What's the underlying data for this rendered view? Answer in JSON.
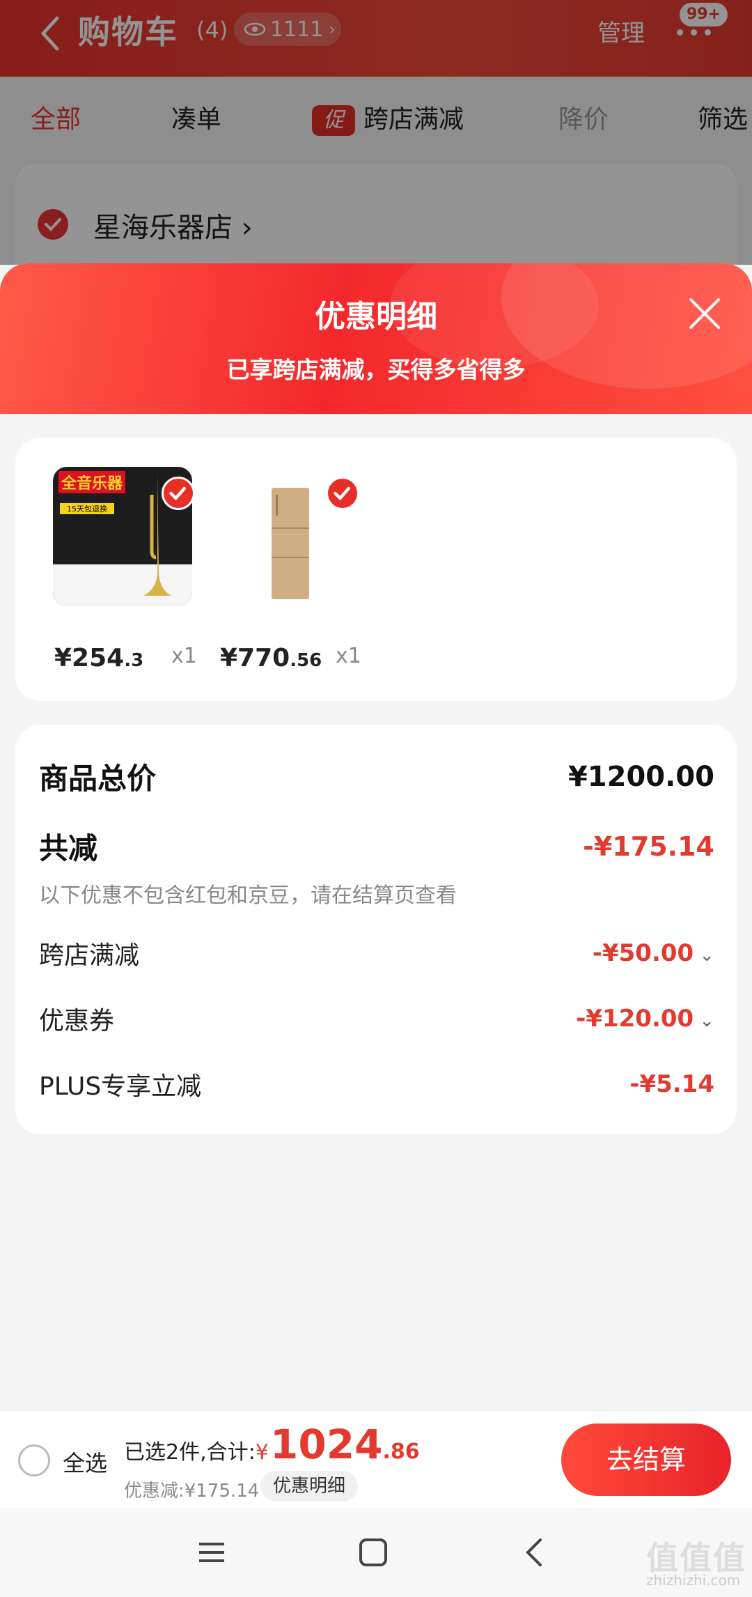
{
  "header": {
    "title": "购物车",
    "count": "(4)",
    "views": "1111",
    "manage": "管理",
    "badge": "99+"
  },
  "tabs": [
    {
      "label": "全部"
    },
    {
      "label": "凑单"
    },
    {
      "label": "跨店满减",
      "promo": "促"
    },
    {
      "label": "降价"
    },
    {
      "label": "筛选"
    }
  ],
  "store": {
    "name": "星海乐器店"
  },
  "sheet": {
    "title": "优惠明细",
    "subtitle": "已享跨店满减，买得多省得多"
  },
  "products": [
    {
      "price_int": "¥254",
      "price_dec": ".3",
      "qty": "x1",
      "img_text": "全音乐器",
      "img_sub": "15天包退换"
    },
    {
      "price_int": "¥770",
      "price_dec": ".56",
      "qty": "x1"
    }
  ],
  "details": {
    "total_label": "商品总价",
    "total_value": "¥1200.00",
    "reduce_label": "共减",
    "reduce_value": "-¥175.14",
    "note": "以下优惠不包含红包和京豆，请在结算页查看",
    "items": [
      {
        "label": "跨店满减",
        "value": "-¥50.00"
      },
      {
        "label": "优惠券",
        "value": "-¥120.00"
      },
      {
        "label": "PLUS专享立减",
        "value": "-¥5.14"
      }
    ]
  },
  "footer": {
    "select_all": "全选",
    "selected": "已选2件,合计:",
    "yen": "¥",
    "total_int": "1024",
    "total_dec": ".86",
    "saved": "优惠减:¥175.14",
    "detail_btn": "优惠明细",
    "checkout": "去结算"
  },
  "watermark": {
    "text": "值值值",
    "url": "zhizhizhi.com"
  },
  "colors": {
    "accent": "#e33a2f",
    "header_red": "#e8312c"
  }
}
